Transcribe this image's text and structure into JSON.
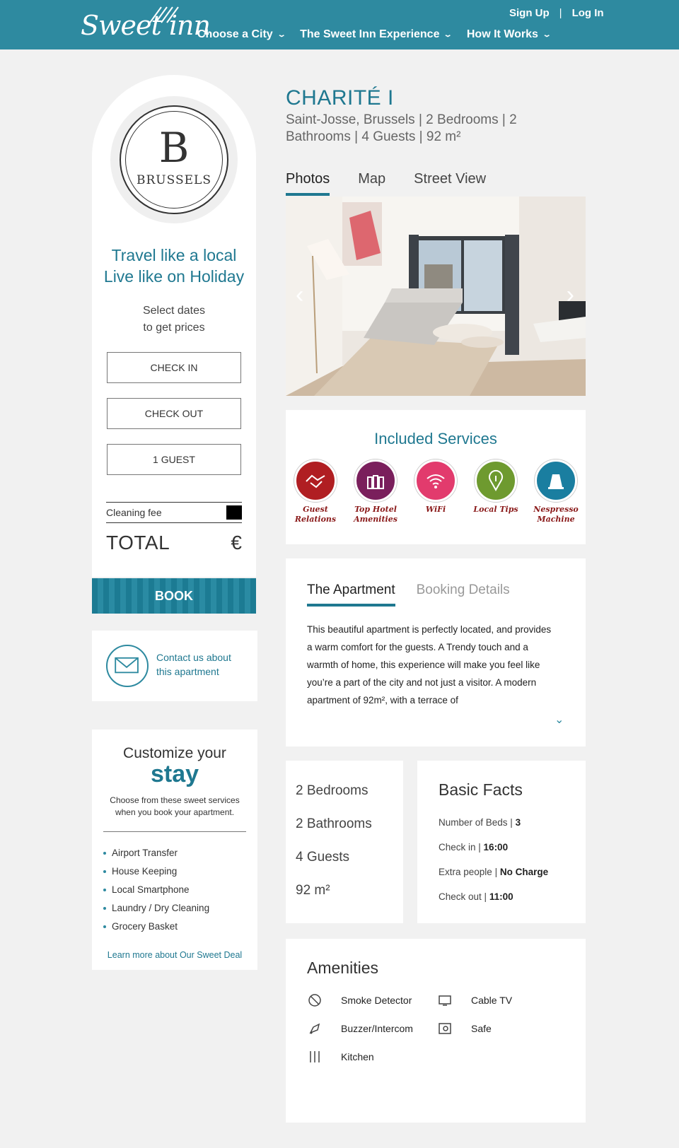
{
  "header": {
    "logo": "Sweet inn",
    "nav": [
      {
        "label": "Choose a City"
      },
      {
        "label": "The Sweet Inn Experience"
      },
      {
        "label": "How It Works"
      }
    ],
    "signup": "Sign Up",
    "separator": "|",
    "login": "Log In"
  },
  "booking": {
    "city_letter": "B",
    "city_name": "BRUSSELS",
    "tagline_1": "Travel like a local",
    "tagline_2": "Live like on Holiday",
    "select_1": "Select dates",
    "select_2": "to get prices",
    "check_in": "CHECK IN",
    "check_out": "CHECK OUT",
    "guests": "1 GUEST",
    "cleaning_fee": "Cleaning fee",
    "total": "TOTAL",
    "currency": "€",
    "book": "BOOK"
  },
  "contact": {
    "line1": "Contact us about",
    "line2": "this apartment"
  },
  "customize": {
    "title": "Customize your",
    "title_big": "stay",
    "desc": "Choose from these sweet services when you book your apartment.",
    "items": [
      "Airport Transfer",
      "House Keeping",
      "Local Smartphone",
      "Laundry / Dry Cleaning",
      "Grocery Basket"
    ],
    "link": "Learn more about Our Sweet Deal"
  },
  "apartment": {
    "title": "CHARITÉ I",
    "subtitle": "Saint-Josse, Brussels | 2 Bedrooms | 2 Bathrooms | 4 Guests | 92 m²",
    "media_tabs": [
      "Photos",
      "Map",
      "Street View"
    ],
    "prev": "‹",
    "next": "›"
  },
  "services": {
    "title": "Included Services",
    "items": [
      {
        "label": "Guest Relations",
        "color": "#b01e22",
        "icon": "handshake-icon"
      },
      {
        "label": "Top Hotel Amenities",
        "color": "#7a1f5c",
        "icon": "bottles-icon"
      },
      {
        "label": "WiFi",
        "color": "#e23b6d",
        "icon": "wifi-icon"
      },
      {
        "label": "Local Tips",
        "color": "#6e9a2f",
        "icon": "map-pin-icon"
      },
      {
        "label": "Nespresso Machine",
        "color": "#1a7ea0",
        "icon": "capsule-icon"
      }
    ]
  },
  "details": {
    "tabs": [
      "The Apartment",
      "Booking Details"
    ],
    "description": "This beautiful apartment is perfectly located, and provides a warm comfort for the guests. A Trendy touch and a warmth of home, this experience will make you feel like you’re a part of the city and not just a visitor. A modern apartment of 92m², with a terrace of",
    "more": "⌄"
  },
  "stats": [
    "2 Bedrooms",
    "2 Bathrooms",
    "4 Guests",
    "92 m²"
  ],
  "facts": {
    "title": "Basic Facts",
    "items": [
      {
        "label": "Number of Beds",
        "value": "3"
      },
      {
        "label": "Check in",
        "value": "16:00"
      },
      {
        "label": "Extra people",
        "value": "No Charge"
      },
      {
        "label": "Check out",
        "value": "11:00"
      }
    ]
  },
  "amenities": {
    "title": "Amenities",
    "items": [
      {
        "label": "Smoke Detector",
        "icon": "smoke-detector-icon"
      },
      {
        "label": "Cable TV",
        "icon": "tv-icon"
      },
      {
        "label": "Buzzer/Intercom",
        "icon": "intercom-icon"
      },
      {
        "label": "Safe",
        "icon": "safe-icon"
      },
      {
        "label": "Kitchen",
        "icon": "kitchen-icon"
      }
    ]
  }
}
